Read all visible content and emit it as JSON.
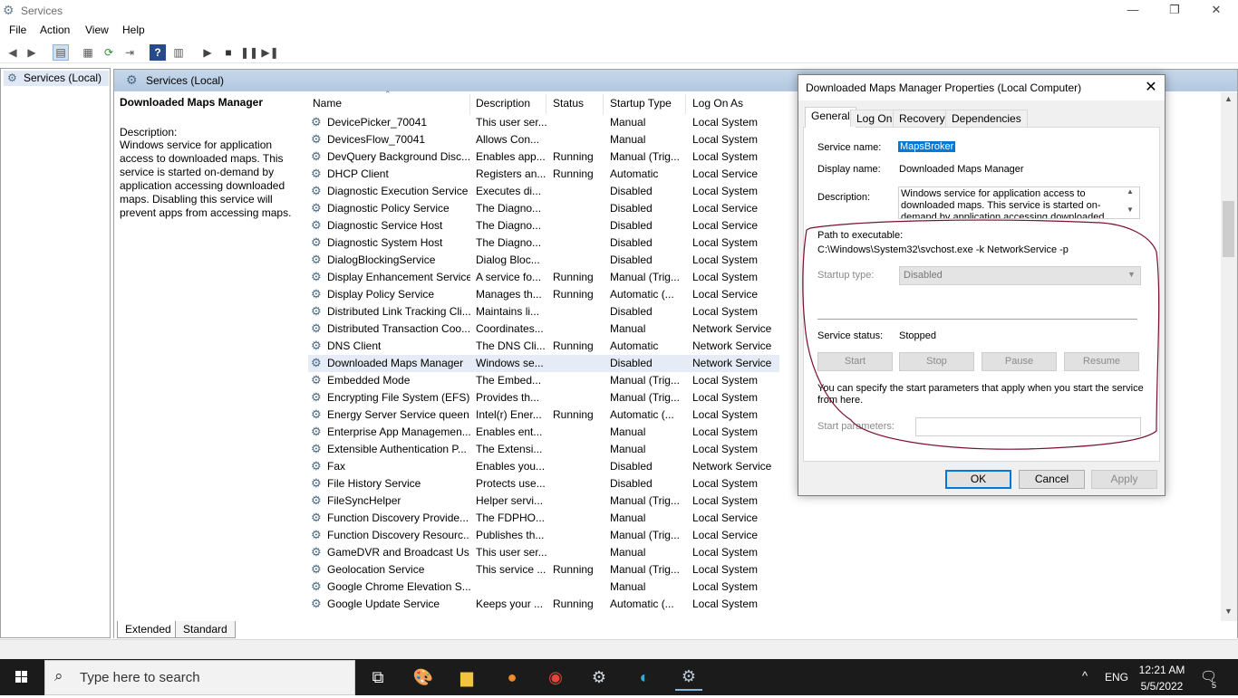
{
  "window": {
    "title": "Services",
    "controls": {
      "minimize": "—",
      "restore": "❐",
      "close": "✕"
    }
  },
  "menu": [
    "File",
    "Action",
    "View",
    "Help"
  ],
  "tree": {
    "item": "Services (Local)"
  },
  "main": {
    "header": "Services (Local)",
    "selected_title": "Downloaded Maps Manager",
    "description_label": "Description:",
    "description_lines": [
      "Windows service for application",
      "access to downloaded maps. This",
      "service is started on-demand by",
      "application accessing downloaded",
      "maps. Disabling this service will",
      "prevent apps from accessing maps."
    ]
  },
  "columns": [
    "Name",
    "Description",
    "Status",
    "Startup Type",
    "Log On As"
  ],
  "services": [
    [
      "DevicePicker_70041",
      "This user ser...",
      "",
      "Manual",
      "Local System"
    ],
    [
      "DevicesFlow_70041",
      "Allows Con...",
      "",
      "Manual",
      "Local System"
    ],
    [
      "DevQuery Background Disc...",
      "Enables app...",
      "Running",
      "Manual (Trig...",
      "Local System"
    ],
    [
      "DHCP Client",
      "Registers an...",
      "Running",
      "Automatic",
      "Local Service"
    ],
    [
      "Diagnostic Execution Service",
      "Executes di...",
      "",
      "Disabled",
      "Local System"
    ],
    [
      "Diagnostic Policy Service",
      "The Diagno...",
      "",
      "Disabled",
      "Local Service"
    ],
    [
      "Diagnostic Service Host",
      "The Diagno...",
      "",
      "Disabled",
      "Local Service"
    ],
    [
      "Diagnostic System Host",
      "The Diagno...",
      "",
      "Disabled",
      "Local System"
    ],
    [
      "DialogBlockingService",
      "Dialog Bloc...",
      "",
      "Disabled",
      "Local System"
    ],
    [
      "Display Enhancement Service",
      "A service fo...",
      "Running",
      "Manual (Trig...",
      "Local System"
    ],
    [
      "Display Policy Service",
      "Manages th...",
      "Running",
      "Automatic (...",
      "Local Service"
    ],
    [
      "Distributed Link Tracking Cli...",
      "Maintains li...",
      "",
      "Disabled",
      "Local System"
    ],
    [
      "Distributed Transaction Coo...",
      "Coordinates...",
      "",
      "Manual",
      "Network Service"
    ],
    [
      "DNS Client",
      "The DNS Cli...",
      "Running",
      "Automatic",
      "Network Service"
    ],
    [
      "Downloaded Maps Manager",
      "Windows se...",
      "",
      "Disabled",
      "Network Service"
    ],
    [
      "Embedded Mode",
      "The Embed...",
      "",
      "Manual (Trig...",
      "Local System"
    ],
    [
      "Encrypting File System (EFS)",
      "Provides th...",
      "",
      "Manual (Trig...",
      "Local System"
    ],
    [
      "Energy Server Service queen...",
      "Intel(r) Ener...",
      "Running",
      "Automatic (...",
      "Local System"
    ],
    [
      "Enterprise App Managemen...",
      "Enables ent...",
      "",
      "Manual",
      "Local System"
    ],
    [
      "Extensible Authentication P...",
      "The Extensi...",
      "",
      "Manual",
      "Local System"
    ],
    [
      "Fax",
      "Enables you...",
      "",
      "Disabled",
      "Network Service"
    ],
    [
      "File History Service",
      "Protects use...",
      "",
      "Disabled",
      "Local System"
    ],
    [
      "FileSyncHelper",
      "Helper servi...",
      "",
      "Manual (Trig...",
      "Local System"
    ],
    [
      "Function Discovery Provide...",
      "The FDPHO...",
      "",
      "Manual",
      "Local Service"
    ],
    [
      "Function Discovery Resourc...",
      "Publishes th...",
      "",
      "Manual (Trig...",
      "Local Service"
    ],
    [
      "GameDVR and Broadcast Us...",
      "This user ser...",
      "",
      "Manual",
      "Local System"
    ],
    [
      "Geolocation Service",
      "This service ...",
      "Running",
      "Manual (Trig...",
      "Local System"
    ],
    [
      "Google Chrome Elevation S...",
      "",
      "",
      "Manual",
      "Local System"
    ],
    [
      "Google Update Service",
      "Keeps your ...",
      "Running",
      "Automatic (...",
      "Local System"
    ]
  ],
  "selected_index": 14,
  "bottom_tabs": [
    "Extended",
    "Standard"
  ],
  "dialog": {
    "title": "Downloaded Maps Manager Properties (Local Computer)",
    "tabs": [
      "General",
      "Log On",
      "Recovery",
      "Dependencies"
    ],
    "service_name_label": "Service name:",
    "service_name": "MapsBroker",
    "display_name_label": "Display name:",
    "display_name": "Downloaded Maps Manager",
    "description_label": "Description:",
    "description_lines": [
      "Windows service for application access to",
      "downloaded maps. This service is started on-",
      "demand by application accessing downloaded"
    ],
    "path_label": "Path to executable:",
    "path": "C:\\Windows\\System32\\svchost.exe -k NetworkService -p",
    "startup_type_label": "Startup type:",
    "startup_type": "Disabled",
    "service_status_label": "Service status:",
    "service_status": "Stopped",
    "service_buttons": [
      "Start",
      "Stop",
      "Pause",
      "Resume"
    ],
    "params_note_line1": "You can specify the start parameters that apply when you start the service",
    "params_note_line2": "from here.",
    "params_label": "Start parameters:",
    "ok": "OK",
    "cancel": "Cancel",
    "apply": "Apply"
  },
  "taskbar": {
    "search_placeholder": "Type here to search",
    "language": "ENG",
    "time": "12:21 AM",
    "date": "5/5/2022",
    "notification_count": "5"
  },
  "colors": {
    "accent": "#0078d7",
    "taskbar": "#1b1b1b",
    "annotation": "#7a1030"
  }
}
